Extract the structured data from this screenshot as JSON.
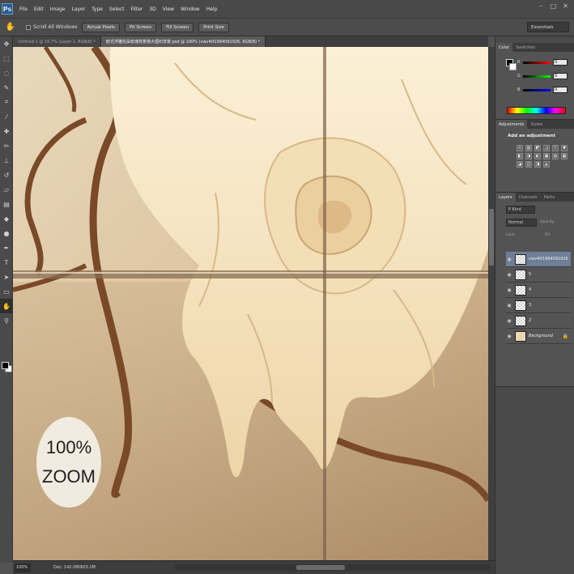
{
  "app": {
    "logo_text": "Ps",
    "menu": [
      "File",
      "Edit",
      "Image",
      "Layer",
      "Type",
      "Select",
      "Filter",
      "3D",
      "View",
      "Window",
      "Help"
    ],
    "window_controls": [
      "–",
      "□",
      "✕"
    ]
  },
  "options_bar": {
    "tool_icon": "hand-icon",
    "scroll_all_label": "Scroll All Windows",
    "buttons": [
      "Actual Pixels",
      "Fit Screen",
      "Fill Screen",
      "Print Size"
    ],
    "workspace": "Essentials"
  },
  "tabs": [
    {
      "label": "Untitled-1 @ 16.7% (Layer 1, RGB/8) *",
      "active": false
    },
    {
      "label": "欧式浮雕花朵玫瑰背景墙大理石背景.psd @ 100% (vwv4tf1994091926, RGB/8) *",
      "active": true
    }
  ],
  "canvas": {
    "zoom_badge_line1": "100%",
    "zoom_badge_line2": "ZOOM"
  },
  "status": {
    "zoom": "100%",
    "doc_info": "Doc: 142.0M/603.1M"
  },
  "panels": {
    "color": {
      "tabs": [
        "Color",
        "Swatches"
      ],
      "sliders": [
        {
          "label": "R",
          "value": "0",
          "color": "#d23b3b"
        },
        {
          "label": "G",
          "value": "0",
          "color": "#3bd23b"
        },
        {
          "label": "B",
          "value": "0",
          "color": "#3b5bd2"
        }
      ]
    },
    "adjustments": {
      "tabs": [
        "Adjustments",
        "Styles"
      ],
      "title": "Add an adjustment",
      "icons": [
        "☼",
        "▥",
        "◩",
        "◿",
        "▽",
        "▼",
        "◧",
        "◑",
        "◐",
        "▣",
        "◍",
        "▦",
        "◪",
        "◫",
        "◨",
        "◭"
      ]
    },
    "layers": {
      "tabs": [
        "Layers",
        "Channels",
        "Paths"
      ],
      "kind": "Ρ Kind",
      "blend": "Normal",
      "opacity_label": "Opacity:",
      "lock_label": "Lock:",
      "fill_label": "Fill:",
      "list": [
        {
          "name": "vwv4tf1994091926",
          "selected": true,
          "italic": false
        },
        {
          "name": "5",
          "selected": false,
          "italic": false
        },
        {
          "name": "4",
          "selected": false,
          "italic": false
        },
        {
          "name": "3",
          "selected": false,
          "italic": false
        },
        {
          "name": "2",
          "selected": false,
          "italic": false
        },
        {
          "name": "Background",
          "selected": false,
          "italic": true
        }
      ]
    }
  }
}
